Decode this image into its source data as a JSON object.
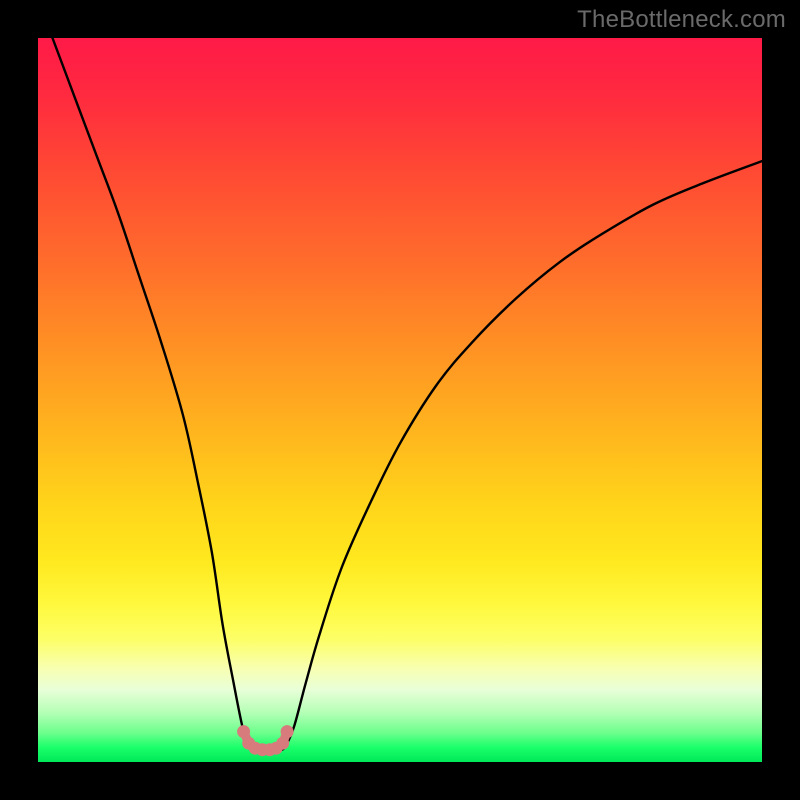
{
  "watermark": {
    "text": "TheBottleneck.com"
  },
  "chart_data": {
    "type": "line",
    "title": "",
    "xlabel": "",
    "ylabel": "",
    "xlim": [
      0,
      100
    ],
    "ylim": [
      0,
      100
    ],
    "grid": false,
    "legend": false,
    "series": [
      {
        "name": "curve",
        "color": "#000000",
        "x": [
          2,
          5,
          8,
          11,
          14,
          17,
          20,
          22,
          24,
          25.5,
          27,
          28.2,
          29,
          29.6,
          30.5,
          32,
          33.5,
          34.3,
          35.4,
          37,
          39,
          42,
          46,
          50,
          55,
          60,
          66,
          72,
          78,
          85,
          92,
          100
        ],
        "y": [
          100,
          92,
          84,
          76,
          67,
          58,
          48,
          39,
          29,
          19,
          11,
          5,
          2.4,
          1.6,
          1.6,
          1.6,
          1.6,
          2.4,
          5,
          11,
          18,
          27,
          36,
          44,
          52,
          58,
          64,
          69,
          73,
          77,
          80,
          83
        ]
      },
      {
        "name": "bottom-markers",
        "color": "#d77b7d",
        "type": "scatter",
        "x": [
          28.4,
          29.1,
          30.0,
          31.0,
          32.0,
          32.9,
          33.8,
          34.4
        ],
        "y": [
          4.2,
          2.6,
          1.9,
          1.7,
          1.7,
          1.9,
          2.6,
          4.2
        ]
      }
    ],
    "background_gradient": {
      "direction": "vertical",
      "stops": [
        {
          "pos": 0.0,
          "color": "#ff1a48"
        },
        {
          "pos": 0.3,
          "color": "#ff6a2c"
        },
        {
          "pos": 0.64,
          "color": "#ffd31a"
        },
        {
          "pos": 0.83,
          "color": "#fdff66"
        },
        {
          "pos": 0.93,
          "color": "#b8ffb8"
        },
        {
          "pos": 1.0,
          "color": "#00e858"
        }
      ]
    }
  }
}
